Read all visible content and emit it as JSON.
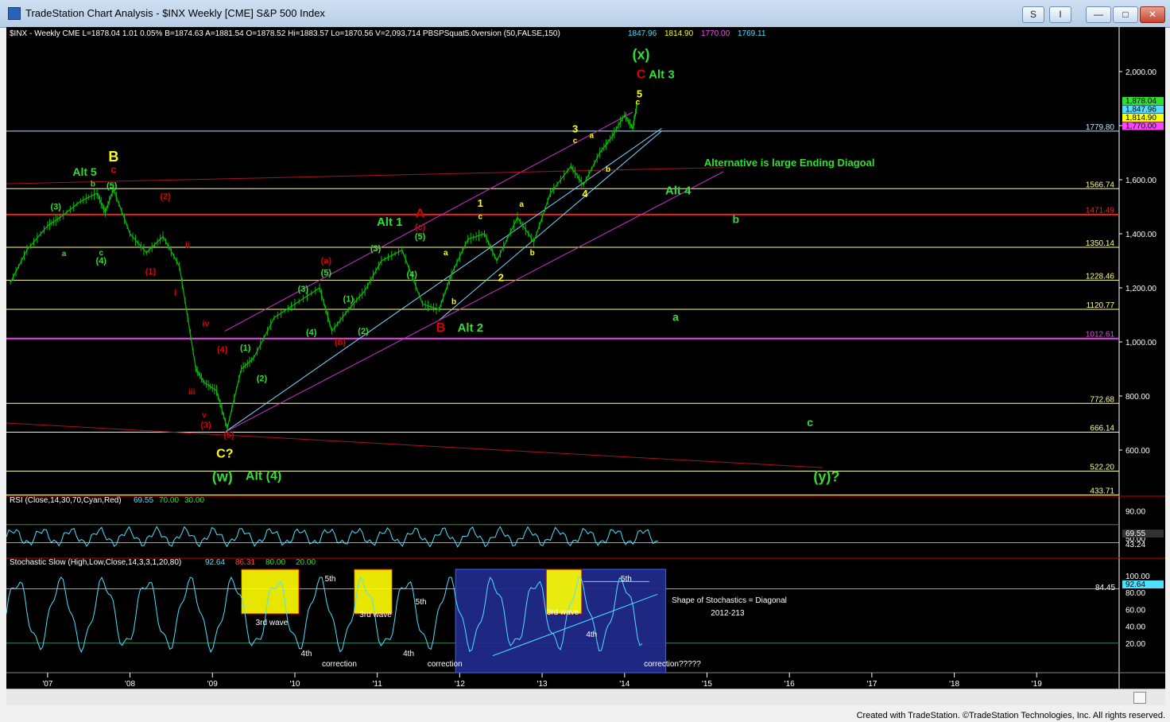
{
  "window": {
    "title": "TradeStation Chart Analysis - $INX Weekly [CME] S&P 500 Index",
    "buttons": [
      "S",
      "I",
      "—",
      "□",
      "✕"
    ]
  },
  "footer": "Created with TradeStation. ©TradeStation Technologies, Inc. All rights reserved.",
  "colors": {
    "background": "#000000",
    "price": "#00c000",
    "green_label": "#33dd33",
    "red_label": "#dd0000",
    "yellow_label": "#ffff00",
    "magenta": "#cc33cc",
    "cyan": "#7fd8ff",
    "dark_red": "#aa1122"
  },
  "chart_data": [
    {
      "type": "line",
      "title": "$INX - Weekly  CME  L=1878.04  1.01  0.05%  B=1874.63  A=1881.54  O=1878.52  Hi=1883.57  Lo=1870.56  V=2,093,714  PBSPSquat5.0version (50,FALSE,150)",
      "indicator_values": [
        "1847.96",
        "1814.90",
        "1770.00",
        "1769.11"
      ],
      "indicator_colors": [
        "#4fe0ff",
        "#ffff00",
        "#ff44ff",
        "#4fe0ff"
      ],
      "x_ticks": [
        "'07",
        "'08",
        "'09",
        "'10",
        "'11",
        "'12",
        "'13",
        "'14",
        "'15",
        "'16",
        "'17",
        "'18",
        "'19"
      ],
      "y_ticks": [
        "2,000.00",
        "1,800.00",
        "1,600.00",
        "1,400.00",
        "1,200.00",
        "1,000.00",
        "800.00",
        "600.00"
      ],
      "series": [
        {
          "name": "$INX",
          "x": [
            2006.55,
            2006.75,
            2007.0,
            2007.15,
            2007.4,
            2007.6,
            2007.7,
            2007.8,
            2008.0,
            2008.2,
            2008.4,
            2008.6,
            2008.8,
            2008.9,
            2009.05,
            2009.18,
            2009.35,
            2009.5,
            2009.75,
            2010.0,
            2010.3,
            2010.45,
            2010.65,
            2010.85,
            2011.05,
            2011.3,
            2011.55,
            2011.75,
            2011.9,
            2012.1,
            2012.3,
            2012.45,
            2012.7,
            2012.9,
            2013.1,
            2013.35,
            2013.5,
            2013.7,
            2013.85,
            2014.0,
            2014.1,
            2014.15
          ],
          "values": [
            1220,
            1340,
            1430,
            1460,
            1520,
            1550,
            1480,
            1565,
            1400,
            1330,
            1390,
            1280,
            900,
            850,
            820,
            680,
            900,
            940,
            1090,
            1140,
            1200,
            1040,
            1120,
            1190,
            1300,
            1340,
            1140,
            1120,
            1250,
            1380,
            1400,
            1300,
            1460,
            1370,
            1550,
            1650,
            1580,
            1700,
            1760,
            1840,
            1790,
            1878
          ]
        }
      ],
      "horizontal_levels": [
        {
          "label": "1779.80",
          "value": 1779.8,
          "color": "#bfe7ff"
        },
        {
          "label": "1566.74",
          "value": 1566.74,
          "color": "#ffff88"
        },
        {
          "label": "1471.49",
          "value": 1471.49,
          "color": "#ee2222"
        },
        {
          "label": "1350.14",
          "value": 1350.14,
          "color": "#ffff88"
        },
        {
          "label": "1228.46",
          "value": 1228.46,
          "color": "#ffff88"
        },
        {
          "label": "1120.77",
          "value": 1120.77,
          "color": "#ffff88"
        },
        {
          "label": "1012.61",
          "value": 1012.61,
          "color": "#ee44ee"
        },
        {
          "label": "772.68",
          "value": 772.68,
          "color": "#ffff88"
        },
        {
          "label": "666.14",
          "value": 666.14,
          "color": "#ffff88"
        },
        {
          "label": "522.20",
          "value": 522.2,
          "color": "#ffff88"
        },
        {
          "label": "433.71",
          "value": 433.71,
          "color": "#ffff88"
        }
      ],
      "last_price_tags": [
        {
          "label": "1,878.04",
          "value": 1878.04,
          "color": "#33dd33"
        },
        {
          "label": "1,847.96",
          "value": 1847.96,
          "color": "#4fe0ff"
        },
        {
          "label": "1,814.90",
          "value": 1814.9,
          "color": "#ffff00"
        },
        {
          "label": "1,770.00",
          "value": 1770.0,
          "color": "#ff44ff"
        }
      ],
      "annotations": [
        {
          "text": "Alt 5",
          "x": 2007.45,
          "y": 1615,
          "color": "#33dd33",
          "size": 14
        },
        {
          "text": "B",
          "x": 2007.8,
          "y": 1668,
          "color": "#ffff00",
          "size": 18
        },
        {
          "text": "c",
          "x": 2007.8,
          "y": 1625,
          "color": "#dd0000",
          "size": 13
        },
        {
          "text": "b",
          "x": 2007.55,
          "y": 1575,
          "color": "#33dd33",
          "size": 10
        },
        {
          "text": "(5)",
          "x": 2007.78,
          "y": 1568,
          "color": "#33dd33",
          "size": 11
        },
        {
          "text": "(3)",
          "x": 2007.1,
          "y": 1490,
          "color": "#33dd33",
          "size": 11
        },
        {
          "text": "a",
          "x": 2007.2,
          "y": 1318,
          "color": "#33dd33",
          "size": 10
        },
        {
          "text": "c",
          "x": 2007.65,
          "y": 1320,
          "color": "#33dd33",
          "size": 10
        },
        {
          "text": "(4)",
          "x": 2007.65,
          "y": 1290,
          "color": "#33dd33",
          "size": 11
        },
        {
          "text": "(2)",
          "x": 2008.43,
          "y": 1528,
          "color": "#dd0000",
          "size": 11
        },
        {
          "text": "ii",
          "x": 2008.7,
          "y": 1348,
          "color": "#dd0000",
          "size": 11
        },
        {
          "text": "(1)",
          "x": 2008.25,
          "y": 1250,
          "color": "#dd0000",
          "size": 11
        },
        {
          "text": "i",
          "x": 2008.55,
          "y": 1170,
          "color": "#dd0000",
          "size": 11
        },
        {
          "text": "iv",
          "x": 2008.92,
          "y": 1057,
          "color": "#dd0000",
          "size": 11
        },
        {
          "text": "(4)",
          "x": 2009.12,
          "y": 962,
          "color": "#dd0000",
          "size": 11
        },
        {
          "text": "iii",
          "x": 2008.75,
          "y": 806,
          "color": "#dd0000",
          "size": 10
        },
        {
          "text": "v",
          "x": 2008.9,
          "y": 720,
          "color": "#dd0000",
          "size": 10
        },
        {
          "text": "(3)",
          "x": 2008.92,
          "y": 683,
          "color": "#dd0000",
          "size": 11
        },
        {
          "text": "(5)",
          "x": 2009.2,
          "y": 646,
          "color": "#dd0000",
          "size": 11
        },
        {
          "text": "C?",
          "x": 2009.15,
          "y": 572,
          "color": "#ffff00",
          "size": 16
        },
        {
          "text": "(w)",
          "x": 2009.12,
          "y": 484,
          "color": "#33dd33",
          "size": 18
        },
        {
          "text": "Alt (4)",
          "x": 2009.62,
          "y": 490,
          "color": "#33dd33",
          "size": 16
        },
        {
          "text": "(1)",
          "x": 2009.4,
          "y": 967,
          "color": "#33dd33",
          "size": 11
        },
        {
          "text": "(2)",
          "x": 2009.6,
          "y": 855,
          "color": "#33dd33",
          "size": 11
        },
        {
          "text": "(3)",
          "x": 2010.1,
          "y": 1185,
          "color": "#33dd33",
          "size": 11
        },
        {
          "text": "(4)",
          "x": 2010.2,
          "y": 1025,
          "color": "#33dd33",
          "size": 11
        },
        {
          "text": "(5)",
          "x": 2010.38,
          "y": 1245,
          "color": "#33dd33",
          "size": 11
        },
        {
          "text": "(a)",
          "x": 2010.38,
          "y": 1290,
          "color": "#dd0000",
          "size": 11
        },
        {
          "text": "(1)",
          "x": 2010.65,
          "y": 1148,
          "color": "#33dd33",
          "size": 11
        },
        {
          "text": "(2)",
          "x": 2010.83,
          "y": 1030,
          "color": "#33dd33",
          "size": 11
        },
        {
          "text": "(b)",
          "x": 2010.55,
          "y": 988,
          "color": "#dd0000",
          "size": 11
        },
        {
          "text": "Alt 1",
          "x": 2011.15,
          "y": 1430,
          "color": "#33dd33",
          "size": 15
        },
        {
          "text": "(3)",
          "x": 2010.98,
          "y": 1335,
          "color": "#33dd33",
          "size": 11
        },
        {
          "text": "A",
          "x": 2011.52,
          "y": 1460,
          "color": "#dd0000",
          "size": 16
        },
        {
          "text": "(c)",
          "x": 2011.52,
          "y": 1415,
          "color": "#dd0000",
          "size": 11
        },
        {
          "text": "(5)",
          "x": 2011.52,
          "y": 1380,
          "color": "#33dd33",
          "size": 11
        },
        {
          "text": "(4)",
          "x": 2011.42,
          "y": 1240,
          "color": "#33dd33",
          "size": 11
        },
        {
          "text": "B",
          "x": 2011.77,
          "y": 1038,
          "color": "#dd0000",
          "size": 16
        },
        {
          "text": "Alt 2",
          "x": 2012.13,
          "y": 1038,
          "color": "#33dd33",
          "size": 15
        },
        {
          "text": "a",
          "x": 2011.83,
          "y": 1320,
          "color": "#ffff00",
          "size": 10
        },
        {
          "text": "b",
          "x": 2011.93,
          "y": 1140,
          "color": "#ffff00",
          "size": 10
        },
        {
          "text": "1",
          "x": 2012.25,
          "y": 1500,
          "color": "#ffff00",
          "size": 13
        },
        {
          "text": "c",
          "x": 2012.25,
          "y": 1455,
          "color": "#ffff00",
          "size": 10
        },
        {
          "text": "2",
          "x": 2012.5,
          "y": 1225,
          "color": "#ffff00",
          "size": 13
        },
        {
          "text": "a",
          "x": 2012.75,
          "y": 1500,
          "color": "#ffff00",
          "size": 10
        },
        {
          "text": "b",
          "x": 2012.88,
          "y": 1320,
          "color": "#ffff00",
          "size": 10
        },
        {
          "text": "3",
          "x": 2013.4,
          "y": 1775,
          "color": "#ffff00",
          "size": 13
        },
        {
          "text": "c",
          "x": 2013.4,
          "y": 1735,
          "color": "#ffff00",
          "size": 10
        },
        {
          "text": "a",
          "x": 2013.6,
          "y": 1755,
          "color": "#ffff00",
          "size": 10
        },
        {
          "text": "4",
          "x": 2013.52,
          "y": 1535,
          "color": "#ffff00",
          "size": 13
        },
        {
          "text": "b",
          "x": 2013.8,
          "y": 1630,
          "color": "#ffff00",
          "size": 10
        },
        {
          "text": "5",
          "x": 2014.18,
          "y": 1905,
          "color": "#ffff00",
          "size": 13
        },
        {
          "text": "c",
          "x": 2014.16,
          "y": 1878,
          "color": "#ffff00",
          "size": 10
        },
        {
          "text": "C",
          "x": 2014.2,
          "y": 1975,
          "color": "#dd0000",
          "size": 16
        },
        {
          "text": "Alt 3",
          "x": 2014.45,
          "y": 1975,
          "color": "#33dd33",
          "size": 15
        },
        {
          "text": "(x)",
          "x": 2014.2,
          "y": 2045,
          "color": "#33dd33",
          "size": 18
        },
        {
          "text": "Alt 5",
          "x": 2015.8,
          "y": 2165,
          "color": "#33dd33",
          "size": 14
        },
        {
          "text": "Alternative is large Ending Diagoal",
          "x": 2016.0,
          "y": 1650,
          "color": "#33dd33",
          "size": 13
        },
        {
          "text": "Alt 4",
          "x": 2014.65,
          "y": 1545,
          "color": "#33dd33",
          "size": 15
        },
        {
          "text": "b",
          "x": 2015.35,
          "y": 1440,
          "color": "#33dd33",
          "size": 14
        },
        {
          "text": "a",
          "x": 2014.62,
          "y": 1078,
          "color": "#33dd33",
          "size": 14
        },
        {
          "text": "c",
          "x": 2016.25,
          "y": 688,
          "color": "#33dd33",
          "size": 14
        },
        {
          "text": "(y)?",
          "x": 2016.45,
          "y": 484,
          "color": "#33dd33",
          "size": 18
        }
      ],
      "trend_lines": [
        {
          "from": [
            2009.15,
            666
          ],
          "to": [
            2014.45,
            1790
          ],
          "color": "#7fd8ff"
        },
        {
          "from": [
            2011.75,
            1080
          ],
          "to": [
            2014.45,
            1780
          ],
          "color": "#7fd8ff"
        },
        {
          "from": [
            2009.15,
            666
          ],
          "to": [
            2015.2,
            1630
          ],
          "color": "#cc33cc"
        },
        {
          "from": [
            2009.15,
            1040
          ],
          "to": [
            2014.1,
            1850
          ],
          "color": "#cc33cc"
        },
        {
          "from": [
            2006.5,
            1585
          ],
          "to": [
            2015.2,
            1645
          ],
          "color": "#aa1122"
        },
        {
          "from": [
            2006.5,
            700
          ],
          "to": [
            2016.4,
            535
          ],
          "color": "#aa1122"
        }
      ]
    },
    {
      "type": "line",
      "title": "RSI (Close,14,30,70,Cyan,Red)",
      "header_values": [
        "69.55",
        "70.00",
        "30.00"
      ],
      "y_ticks": [
        "90.00",
        "50.00"
      ],
      "tags": [
        {
          "label": "69.55",
          "value": 69.55,
          "color": "#ffffff"
        },
        {
          "label": "43.24",
          "value": 43.24,
          "color": "#ffffff"
        }
      ]
    },
    {
      "type": "line",
      "title": "Stochastic Slow (High,Low,Close,14,3,3,1,20,80)",
      "header_values": [
        "92.64",
        "86.31",
        "80.00",
        "20.00"
      ],
      "y_ticks": [
        "100.00",
        "80.00",
        "60.00",
        "40.00",
        "20.00"
      ],
      "tags": [
        {
          "label": "92.64",
          "value": 92.64,
          "color": "#4fe0ff"
        },
        {
          "label": "84.45",
          "value": 84.45,
          "color": "#ffffff"
        }
      ],
      "annotations": [
        {
          "text": "3rd wave",
          "x": 2009.72,
          "color": "#ffffff"
        },
        {
          "text": "5th",
          "x": 2010.43,
          "color": "#ffffff"
        },
        {
          "text": "4th",
          "x": 2010.14,
          "color": "#ffffff"
        },
        {
          "text": "correction",
          "x": 2010.54,
          "color": "#ffffff"
        },
        {
          "text": "3rd wave",
          "x": 2010.98,
          "color": "#ffffff"
        },
        {
          "text": "5th",
          "x": 2011.53,
          "color": "#ffffff"
        },
        {
          "text": "4th",
          "x": 2011.38,
          "color": "#ffffff"
        },
        {
          "text": "correction",
          "x": 2011.82,
          "color": "#ffffff"
        },
        {
          "text": "3rd wave",
          "x": 2013.25,
          "color": "#ffffff"
        },
        {
          "text": "4th",
          "x": 2013.6,
          "color": "#ffffff"
        },
        {
          "text": "5th",
          "x": 2014.02,
          "color": "#ffffff"
        },
        {
          "text": "correction?????",
          "x": 2014.58,
          "color": "#ffffff"
        },
        {
          "text": "Shape of Stochastics = Diagonal",
          "x": 2015.27,
          "color": "#ffffff"
        },
        {
          "text": "2012-213",
          "x": 2015.25,
          "color": "#ffffff"
        }
      ]
    }
  ]
}
